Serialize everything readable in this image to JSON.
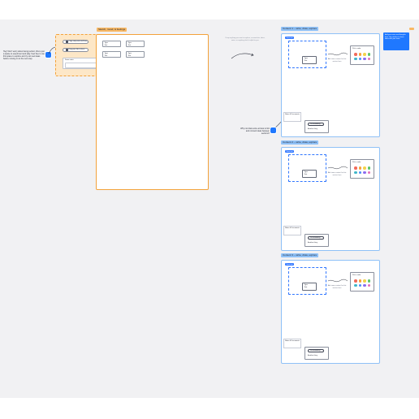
{
  "canvas": {
    "background": "#f1f1f3",
    "accent_orange": "#f3a23a",
    "accent_blue": "#2f76ff"
  },
  "instructions": {
    "left_note": "Hey! Don't worry about being perfect, this is just a space to experiment and play. Feel free to use this space to explore and try out new ideas before moving on to the next step.",
    "hint_text": "Drop anything you want to explore, screenshots, ideas, notes, or anything that's helpful to you.",
    "center_note": "Why not draw some arrows to link and connect ideas between sections?",
    "right_sticky": "Add your notes and thoughts here. Use stickies to share ideas with your team."
  },
  "toolbox": {
    "pill_1": "Copy and paste stuff here",
    "pill_2": "Drag your files in here",
    "card_title": "Some notes"
  },
  "orange_frame": {
    "label": "Sketch, mood, & feelings",
    "stickies": [
      {
        "title": "Type",
        "body": "Text"
      },
      {
        "title": "Type",
        "body": "Text"
      },
      {
        "title": "Type",
        "body": "Text"
      },
      {
        "title": "Type",
        "body": "Text"
      }
    ]
  },
  "sections": [
    {
      "label": "Content 1 – write, draw, explore",
      "tag": "Some text",
      "note_title": "Type",
      "note_body": "Text",
      "palette_title": "Pick a color",
      "caption": "Add some context for this section here",
      "doc": "Notes & Documents",
      "btn_1": "Do something",
      "btn_2": "Another thing"
    },
    {
      "label": "Content 2 – write, draw, explore",
      "tag": "Some text",
      "note_title": "Type",
      "note_body": "Text",
      "palette_title": "Pick a color",
      "caption": "Add some context for this section here",
      "doc": "Notes & Documents",
      "btn_1": "Do something",
      "btn_2": "Another thing"
    },
    {
      "label": "Content 3 – write, draw, explore",
      "tag": "Some text",
      "note_title": "Type",
      "note_body": "Text",
      "palette_title": "Pick a color",
      "caption": "Add some context for this section here",
      "doc": "Notes & Documents",
      "btn_1": "Do something",
      "btn_2": "Another thing"
    }
  ],
  "palette_colors": [
    "#f26b5b",
    "#f6a23a",
    "#f3d34a",
    "#5cc36b",
    "#3fb6c9",
    "#4f8df5",
    "#8c6cf0",
    "#e36fb8"
  ]
}
